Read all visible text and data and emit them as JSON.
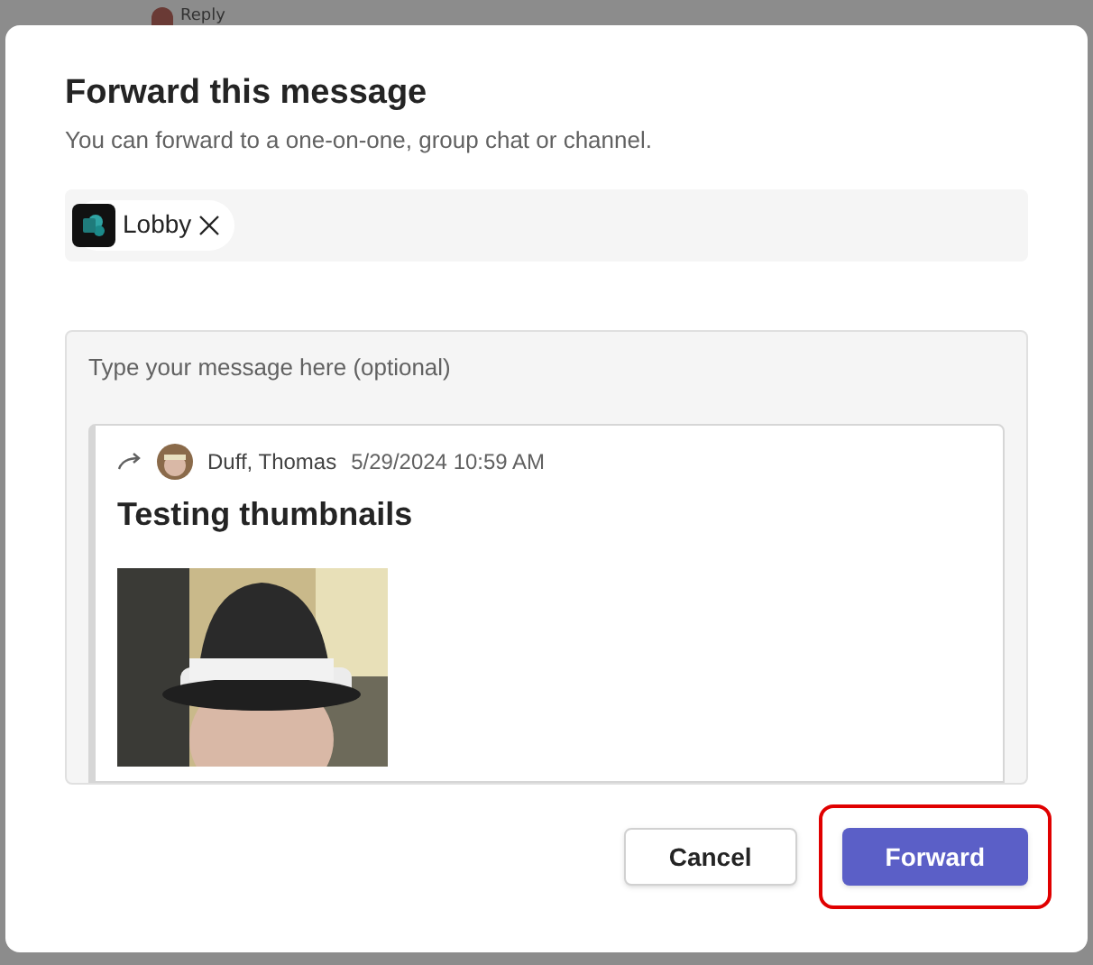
{
  "background": {
    "reply_label": "Reply"
  },
  "dialog": {
    "title": "Forward this message",
    "subtitle": "You can forward to a one-on-one, group chat or channel.",
    "recipients": [
      {
        "label": "Lobby"
      }
    ],
    "message_field": {
      "placeholder": "Type your message here (optional)"
    },
    "quoted_message": {
      "author": "Duff, Thomas",
      "timestamp": "5/29/2024 10:59 AM",
      "text": "Testing thumbnails"
    },
    "buttons": [
      {
        "label": "Cancel",
        "kind": "secondary",
        "highlighted": false
      },
      {
        "label": "Forward",
        "kind": "primary",
        "highlighted": true
      }
    ]
  }
}
